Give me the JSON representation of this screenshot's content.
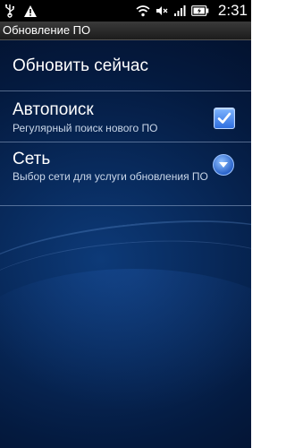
{
  "status_bar": {
    "left_icons": [
      "usb-icon",
      "warning-icon"
    ],
    "right_icons": [
      "wifi-icon",
      "mute-icon",
      "signal-icon",
      "battery-icon"
    ],
    "time": "2:31"
  },
  "title_bar": {
    "title": "Обновление ПО"
  },
  "settings": {
    "update_now": {
      "title": "Обновить сейчас"
    },
    "autosearch": {
      "title": "Автопоиск",
      "subtitle": "Регулярный поиск нового ПО",
      "checked": true
    },
    "network": {
      "title": "Сеть",
      "subtitle": "Выбор сети для услуги обновления ПО"
    }
  },
  "colors": {
    "accent": "#2f6fe0",
    "background": "#041a3f",
    "divider": "#b4c8e6"
  }
}
